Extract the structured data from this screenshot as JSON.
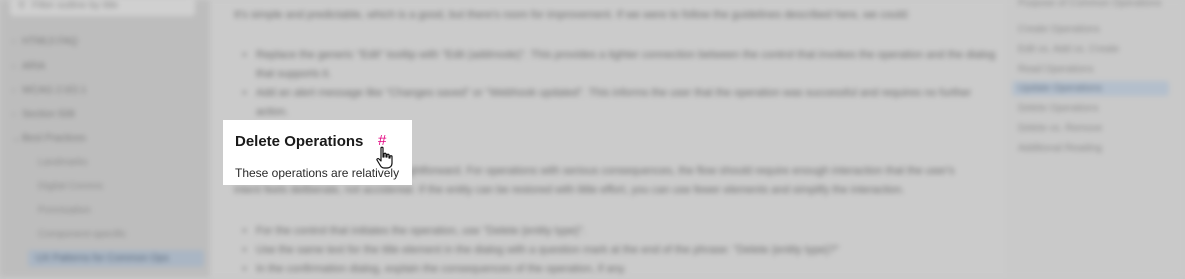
{
  "sidebar": {
    "search_placeholder": "Filter outline by title",
    "items": [
      {
        "label": "HTML5 FAQ"
      },
      {
        "label": "ARIA"
      },
      {
        "label": "WCAG 2.0/2.1"
      },
      {
        "label": "Section 508"
      },
      {
        "label": "Best Practices"
      },
      {
        "label": "Landmarks"
      },
      {
        "label": "Digital Comms"
      },
      {
        "label": "Punctuation"
      },
      {
        "label": "Component-specific"
      },
      {
        "label": "UX Patterns for Common Ops"
      }
    ]
  },
  "main": {
    "intro_text": "It's simple and predictable, which is a good, but there's room for improvement. If we were to follow the guidelines described here, we could:",
    "bullets_top": [
      "Replace the generic \"Edit\" tooltip with \"Edit (addmode)\". This provides a tighter connection between the control that invokes the operation and the dialog that supports it.",
      "Add an alert message like \"Changes saved\" or \"Webhook updated\". This informs the user that the operation was successful and requires no further action."
    ],
    "section_heading": "Delete Operations",
    "anchor_symbol": "#",
    "section_intro": "These operations are relatively",
    "section_body": "These operations are relatively straightforward. For operations with serious consequences, the flow should require enough interaction that the user's intent feels deliberate, not accidental. If the entity can be restored with little effort, you can use fewer elements and simplify the interaction.",
    "bullets_bottom": [
      "For the control that initiates the operation, use \"Delete {entity type}\".",
      "Use the same text for the title element in the dialog with a question mark at the end of the phrase: \"Delete {entity type}?\"",
      "In the confirmation dialog, explain the consequences of the operation, if any."
    ]
  },
  "toc": {
    "items": [
      {
        "label": "Purpose of Common Operations",
        "active": false
      },
      {
        "label": "Create Operations",
        "active": false
      },
      {
        "label": "Edit vs. Add vs. Create",
        "active": false
      },
      {
        "label": "Read Operations",
        "active": false
      },
      {
        "label": "Update Operations",
        "active": true
      },
      {
        "label": "Delete Operations",
        "active": false
      },
      {
        "label": "Delete vs. Remove",
        "active": false
      },
      {
        "label": "Additional Reading",
        "active": false
      }
    ]
  }
}
